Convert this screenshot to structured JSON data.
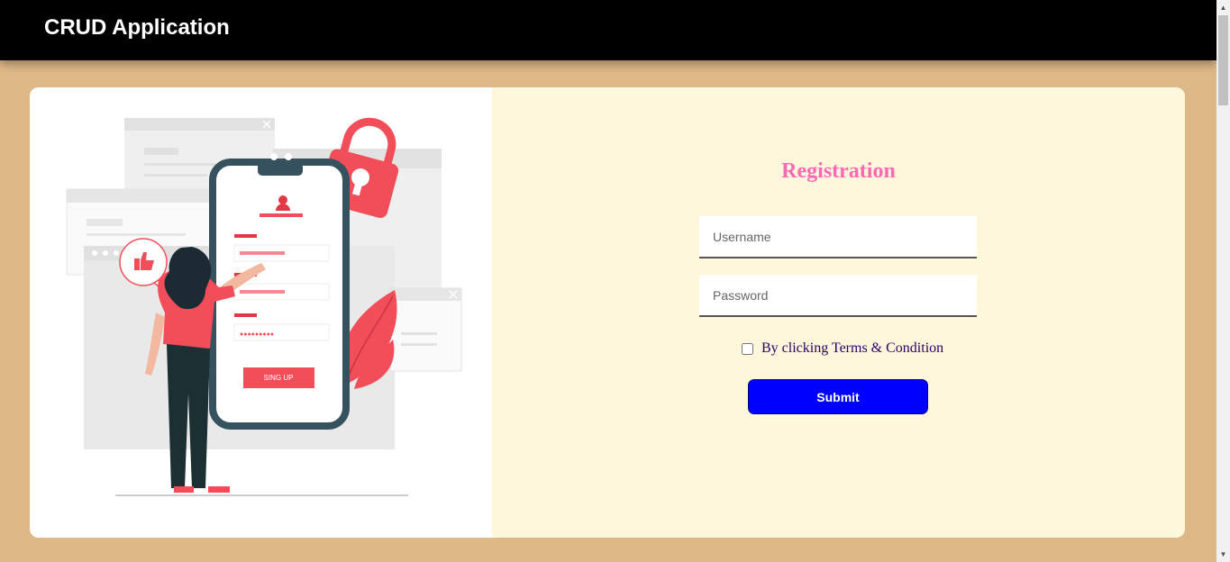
{
  "navbar": {
    "brand": "CRUD Application"
  },
  "illustration": {
    "button_text": "SING UP",
    "password_dots": "●●●●●●●●●"
  },
  "form": {
    "title": "Registration",
    "username_placeholder": "Username",
    "password_placeholder": "Password",
    "terms_label": "By clicking Terms & Condition",
    "terms_checked": false,
    "submit_label": "Submit"
  },
  "colors": {
    "navbar_bg": "#000000",
    "page_bg": "#deb887",
    "form_panel_bg": "#fff7dc",
    "title_color": "#ff69b4",
    "submit_bg": "#0000ff",
    "accent_red": "#f24e5a"
  },
  "icons": [
    "padlock-icon",
    "thumbs-up-icon",
    "user-icon",
    "close-icon",
    "leaf-icon"
  ]
}
